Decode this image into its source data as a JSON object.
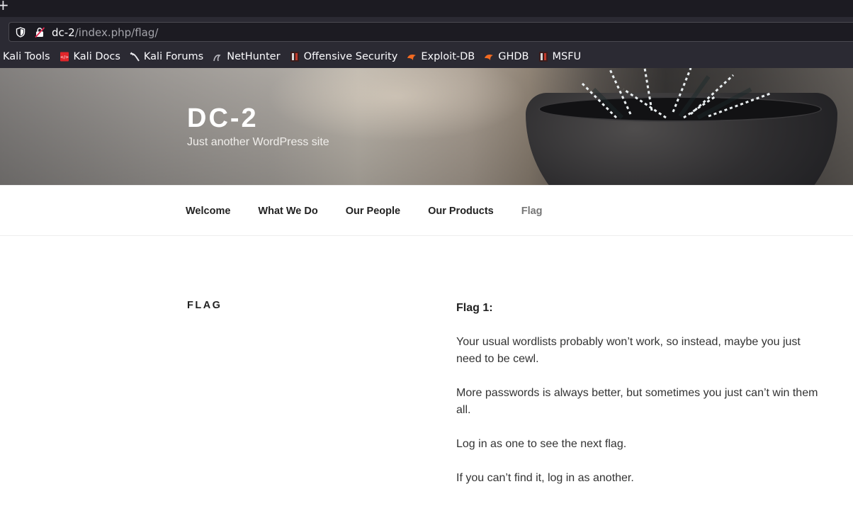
{
  "browser": {
    "newtab_glyph": "+",
    "url_host": "dc-2",
    "url_path": "/index.php/flag/",
    "bookmarks": [
      {
        "label": "Kali Tools",
        "icon": "none"
      },
      {
        "label": "Kali Docs",
        "icon": "kali-docs-icon"
      },
      {
        "label": "Kali Forums",
        "icon": "kali-forums-icon"
      },
      {
        "label": "NetHunter",
        "icon": "nethunter-icon"
      },
      {
        "label": "Offensive Security",
        "icon": "offsec-icon"
      },
      {
        "label": "Exploit-DB",
        "icon": "exploitdb-icon"
      },
      {
        "label": "GHDB",
        "icon": "ghdb-icon"
      },
      {
        "label": "MSFU",
        "icon": "msfu-icon"
      }
    ]
  },
  "site": {
    "title": "DC-2",
    "description": "Just another WordPress site"
  },
  "nav": {
    "items": [
      "Welcome",
      "What We Do",
      "Our People",
      "Our Products",
      "Flag"
    ]
  },
  "page": {
    "title": "Flag",
    "heading": "Flag 1:",
    "paragraphs": [
      "Your usual wordlists probably won’t work, so instead, maybe you just need to be cewl.",
      "More passwords is always better, but sometimes you just can’t win them all.",
      "Log in as one to see the next flag.",
      "If you can’t find it, log in as another."
    ]
  },
  "colors": {
    "chrome_dark": "#1c1b22",
    "chrome": "#2b2a33",
    "nav_current": "#767676",
    "text": "#333333"
  }
}
